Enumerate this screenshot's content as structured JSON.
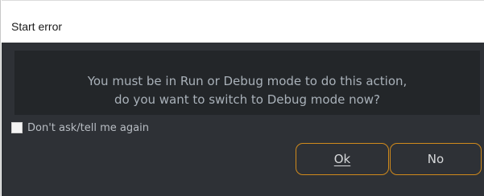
{
  "window": {
    "title": "Start error"
  },
  "message": {
    "line1": "You must be in Run or Debug mode to do this action,",
    "line2": "do you want to switch to Debug mode now?"
  },
  "checkbox": {
    "label": "Don't ask/tell me again",
    "checked": false
  },
  "buttons": {
    "ok_label": "Ok",
    "no_label": "No"
  },
  "colors": {
    "accent": "#d08a1c",
    "background": "#2e3136",
    "panel": "#232629",
    "text": "#a9b1b9"
  }
}
